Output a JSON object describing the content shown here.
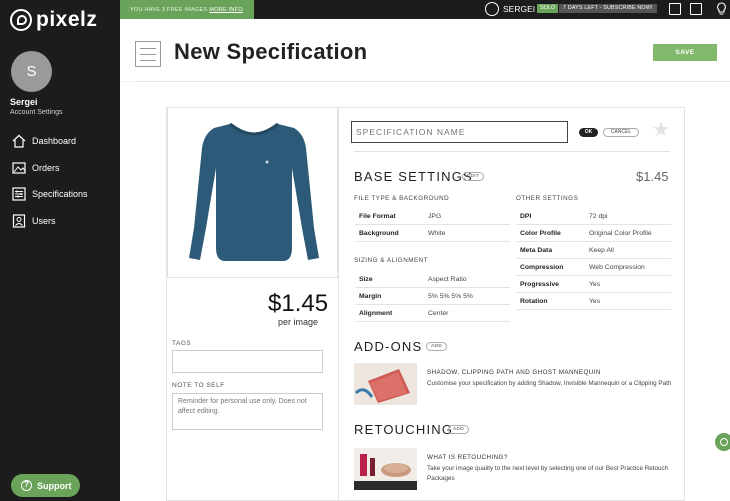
{
  "app": {
    "logo_text": "pixelz"
  },
  "sidebar": {
    "avatar_initial": "S",
    "user_name": "Sergei",
    "account_settings": "Account Settings",
    "items": [
      {
        "label": "Dashboard",
        "icon": "home-icon"
      },
      {
        "label": "Orders",
        "icon": "image-icon"
      },
      {
        "label": "Specifications",
        "icon": "sliders-icon"
      },
      {
        "label": "Users",
        "icon": "user-icon"
      }
    ],
    "support_label": "Support"
  },
  "topbar": {
    "promo_text": "YOU HAVE 3 FREE IMAGES",
    "promo_link": "MORE INFO",
    "user": "SERGEI",
    "plan_badge": "SOLO",
    "trial_text": "7 DAYS LEFT - SUBSCRIBE NOW!"
  },
  "header": {
    "title": "New Specification",
    "save_label": "SAVE"
  },
  "preview": {
    "price": "$1.45",
    "per_image": "per image",
    "tags_label": "TAGS",
    "tags_value": "",
    "note_label": "NOTE TO SELF",
    "note_placeholder": "Reminder for personal use only. Does not affect editing."
  },
  "spec": {
    "name_placeholder": "SPECIFICATION NAME",
    "ok_label": "OK",
    "cancel_label": "CANCEL",
    "base_settings": {
      "title": "BASE SETTINGS",
      "edit_label": "EDIT",
      "price": "$1.45",
      "file_type_label": "FILE TYPE & BACKGROUND",
      "file_type_rows": [
        {
          "k": "File Format",
          "v": "JPG"
        },
        {
          "k": "Background",
          "v": "White"
        }
      ],
      "sizing_label": "SIZING & ALIGNMENT",
      "sizing_rows": [
        {
          "k": "Size",
          "v": "Aspect Ratio"
        },
        {
          "k": "Margin",
          "v": "5% 5% 5% 5%"
        },
        {
          "k": "Alignment",
          "v": "Center"
        }
      ],
      "other_label": "OTHER SETTINGS",
      "other_rows": [
        {
          "k": "DPI",
          "v": "72 dpi"
        },
        {
          "k": "Color Profile",
          "v": "Original Color Profile"
        },
        {
          "k": "Meta Data",
          "v": "Keep All"
        },
        {
          "k": "Compression",
          "v": "Web Compression"
        },
        {
          "k": "Progressive",
          "v": "Yes"
        },
        {
          "k": "Rotation",
          "v": "Yes"
        }
      ]
    },
    "addons": {
      "title": "ADD-ONS",
      "add_label": "ADD",
      "feature_title": "SHADOW, CLIPPING PATH AND GHOST MANNEQUIN",
      "feature_desc": "Customise your specification by adding Shadow, Invisible Mannequin or a Clipping Path"
    },
    "retouching": {
      "title": "RETOUCHING",
      "add_label": "ADD",
      "feature_title": "WHAT IS RETOUCHING?",
      "feature_desc": "Take your image quality to the next level by selecting one of our Best Practice Retouch Packages"
    }
  }
}
